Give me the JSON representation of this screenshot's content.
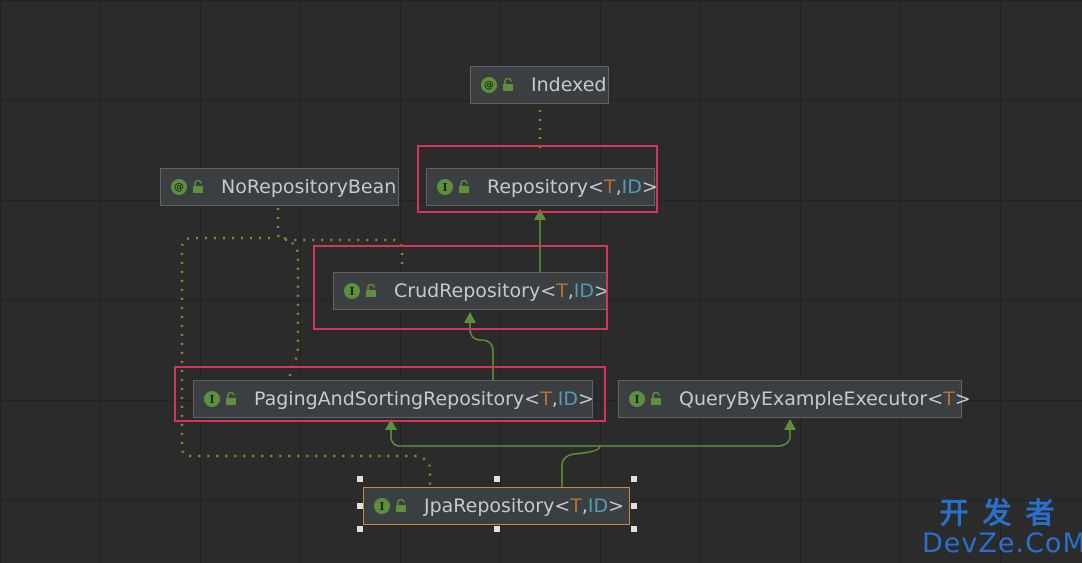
{
  "diagram": {
    "nodes": [
      {
        "id": "indexed",
        "kind": "annotation",
        "badge": "@",
        "name": "Indexed"
      },
      {
        "id": "repository",
        "kind": "interface",
        "badge": "I",
        "name": "Repository",
        "type_params": [
          "T",
          "ID"
        ]
      },
      {
        "id": "norepositorybean",
        "kind": "annotation",
        "badge": "@",
        "name": "NoRepositoryBean"
      },
      {
        "id": "crudrepository",
        "kind": "interface",
        "badge": "I",
        "name": "CrudRepository",
        "type_params": [
          "T",
          "ID"
        ]
      },
      {
        "id": "pagingandsortingrepository",
        "kind": "interface",
        "badge": "I",
        "name": "PagingAndSortingRepository",
        "type_params": [
          "T",
          "ID"
        ]
      },
      {
        "id": "querybyexampleexecutor",
        "kind": "interface",
        "badge": "I",
        "name": "QueryByExampleExecutor",
        "type_params": [
          "T"
        ]
      },
      {
        "id": "jparepository",
        "kind": "interface",
        "badge": "I",
        "name": "JpaRepository",
        "type_params": [
          "T",
          "ID"
        ],
        "selected": true
      }
    ],
    "edges": [
      {
        "from": "repository",
        "to": "indexed",
        "style": "annotation-dotted"
      },
      {
        "from": "crudrepository",
        "to": "repository",
        "style": "extends"
      },
      {
        "from": "pagingandsortingrepository",
        "to": "crudrepository",
        "style": "extends"
      },
      {
        "from": "jparepository",
        "to": "pagingandsortingrepository",
        "style": "extends"
      },
      {
        "from": "jparepository",
        "to": "querybyexampleexecutor",
        "style": "extends"
      },
      {
        "from": "crudrepository",
        "to": "norepositorybean",
        "style": "annotation-dotted"
      },
      {
        "from": "pagingandsortingrepository",
        "to": "norepositorybean",
        "style": "annotation-dotted"
      },
      {
        "from": "jparepository",
        "to": "norepositorybean",
        "style": "annotation-dotted"
      }
    ],
    "highlighted": [
      "repository",
      "crudrepository",
      "pagingandsortingrepository"
    ]
  },
  "colors": {
    "background": "#2b2b2b",
    "node_fill": "#3c3f41",
    "extends_edge": "#5d8f3e",
    "annotation_edge": "#8a8a2a",
    "highlight": "#d8335a",
    "type_param_t": "#b7702f",
    "type_param_id": "#4e9db5",
    "watermark": "#2a6fc9"
  },
  "watermark": {
    "line1": "开发者",
    "line2": "DevZe.CoM"
  }
}
